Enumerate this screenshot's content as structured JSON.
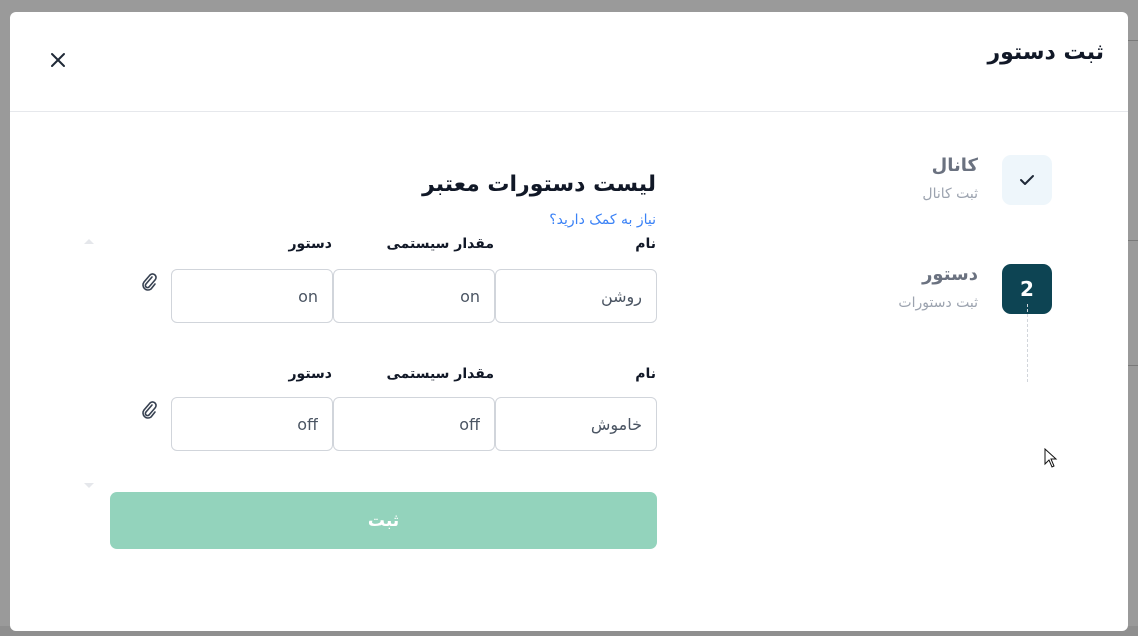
{
  "modal": {
    "title": "ثبت دستور"
  },
  "stepper": {
    "steps": [
      {
        "title": "کانال",
        "subtitle": "ثبت کانال",
        "state": "done",
        "icon": "check-icon"
      },
      {
        "title": "دستور",
        "subtitle": "ثبت دستورات",
        "state": "active",
        "number": "2"
      }
    ]
  },
  "form": {
    "title": "لیست دستورات معتبر",
    "help_link": "نیاز به کمک دارید؟",
    "rows": [
      {
        "name_label": "نام",
        "system_value_label": "مقدار سیستمی",
        "command_label": "دستور",
        "name_value": "روشن",
        "system_value": "on",
        "command_value": "on"
      },
      {
        "name_label": "نام",
        "system_value_label": "مقدار سیستمی",
        "command_label": "دستور",
        "name_value": "خاموش",
        "system_value": "off",
        "command_value": "off"
      }
    ],
    "submit_label": "ثبت"
  },
  "colors": {
    "primary_dark": "#0d4453",
    "submit_disabled": "#93d3bc",
    "link": "#3b82f6"
  }
}
